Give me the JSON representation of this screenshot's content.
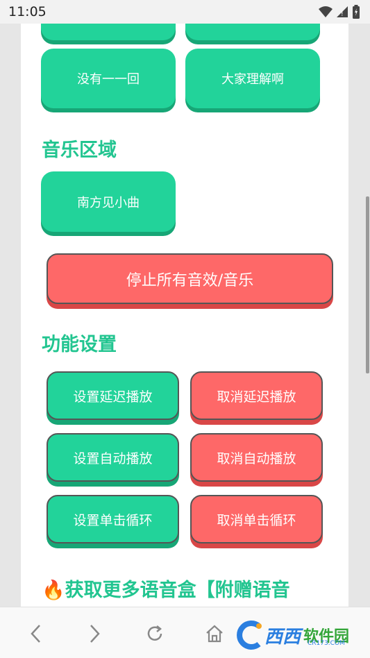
{
  "status": {
    "time": "11:05"
  },
  "buttons_top": [
    "没有一一回",
    "大家理解啊"
  ],
  "sections": {
    "music_title": "音乐区域",
    "function_title": "功能设置"
  },
  "music_button": "南方见小曲",
  "stop_button": "停止所有音效/音乐",
  "settings": {
    "set_delay": "设置延迟播放",
    "cancel_delay": "取消延迟播放",
    "set_auto": "设置自动播放",
    "cancel_auto": "取消自动播放",
    "set_single": "设置单击循环",
    "cancel_single": "取消单击循环"
  },
  "promo": {
    "emoji": "🔥",
    "text": "获取更多语音盒【附赠语音"
  },
  "watermark": {
    "logo_text": "西西",
    "site": "软件园",
    "domain": "CR173.COM"
  },
  "colors": {
    "green": "#22d39a",
    "red": "#fe6868",
    "title_green": "#22c590"
  }
}
